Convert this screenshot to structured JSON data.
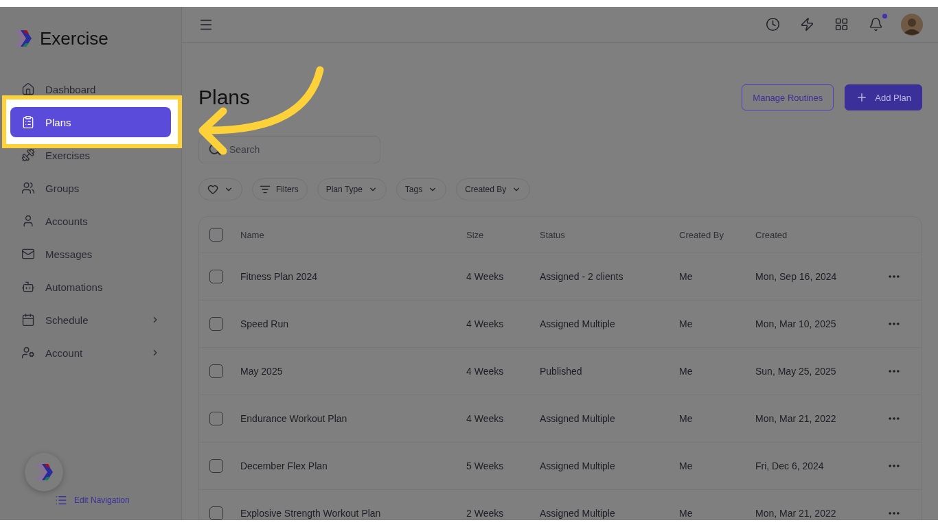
{
  "brand": {
    "name": "Exercise"
  },
  "sidebar": {
    "items": [
      {
        "label": "Dashboard",
        "selected": false,
        "expandable": false
      },
      {
        "label": "Plans",
        "selected": true,
        "expandable": false
      },
      {
        "label": "Exercises",
        "selected": false,
        "expandable": false
      },
      {
        "label": "Groups",
        "selected": false,
        "expandable": false
      },
      {
        "label": "Accounts",
        "selected": false,
        "expandable": false
      },
      {
        "label": "Messages",
        "selected": false,
        "expandable": false
      },
      {
        "label": "Automations",
        "selected": false,
        "expandable": false
      },
      {
        "label": "Schedule",
        "selected": false,
        "expandable": true
      },
      {
        "label": "Account",
        "selected": false,
        "expandable": true
      }
    ],
    "edit_link": "Edit Navigation"
  },
  "topbar": {
    "notification_dot": true
  },
  "page": {
    "title": "Plans",
    "buttons": [
      {
        "label": "Manage Routines",
        "kind": "outline"
      },
      {
        "label": "Add Plan",
        "kind": "primary"
      }
    ],
    "search": {
      "placeholder": "Search"
    },
    "filters": [
      {
        "kind": "favorite"
      },
      {
        "kind": "filter",
        "label": "Filters"
      },
      {
        "kind": "dropdown",
        "label": "Plan Type"
      },
      {
        "kind": "dropdown",
        "label": "Tags"
      },
      {
        "kind": "dropdown",
        "label": "Created By"
      }
    ]
  },
  "table": {
    "header_checked": false,
    "columns": [
      "Name",
      "Size",
      "Status",
      "Created By",
      "Created"
    ],
    "rows": [
      {
        "checked": false,
        "cells": [
          "Fitness Plan 2024",
          "4 Weeks",
          "Assigned - 2 clients",
          "Me",
          "Mon, Sep 16, 2024"
        ]
      },
      {
        "checked": false,
        "cells": [
          "Speed Run",
          "4 Weeks",
          "Assigned Multiple",
          "Me",
          "Mon, Mar 10, 2025"
        ]
      },
      {
        "checked": false,
        "cells": [
          "May 2025",
          "4 Weeks",
          "Published",
          "Me",
          "Sun, May 25, 2025"
        ]
      },
      {
        "checked": false,
        "cells": [
          "Endurance Workout Plan",
          "4 Weeks",
          "Assigned Multiple",
          "Me",
          "Mon, Mar 21, 2022"
        ]
      },
      {
        "checked": false,
        "cells": [
          "December Flex Plan",
          "5 Weeks",
          "Assigned Multiple",
          "Me",
          "Fri, Dec 6, 2024"
        ]
      },
      {
        "checked": false,
        "cells": [
          "Explosive Strength Workout Plan",
          "2 Weeks",
          "Assigned Multiple",
          "Me",
          "Mon, Mar 21, 2022"
        ]
      }
    ]
  }
}
